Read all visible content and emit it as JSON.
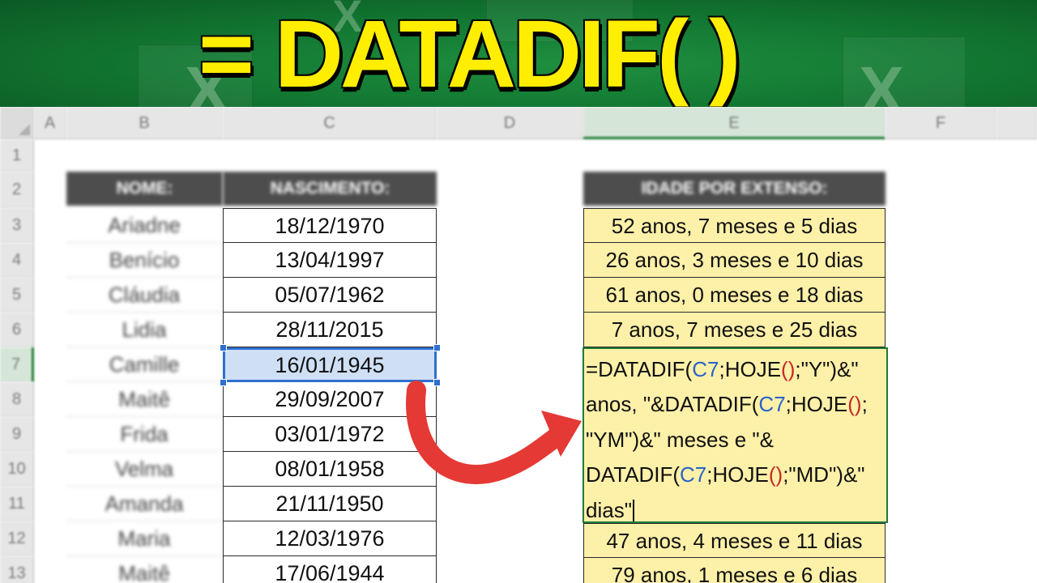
{
  "banner": {
    "title": "= DATADIF(  )",
    "logo_letter": "X"
  },
  "columns": [
    "A",
    "B",
    "C",
    "D",
    "E",
    "F"
  ],
  "rows": [
    "1",
    "2",
    "3",
    "4",
    "5",
    "6",
    "7",
    "8",
    "9",
    "10",
    "11",
    "12",
    "13"
  ],
  "headers": {
    "nome": "NOME:",
    "nascimento": "NASCIMENTO:",
    "idade": "IDADE POR EXTENSO:"
  },
  "people": [
    {
      "name": "Ariadne",
      "birth": "18/12/1970"
    },
    {
      "name": "Benício",
      "birth": "13/04/1997"
    },
    {
      "name": "Cláudia",
      "birth": "05/07/1962"
    },
    {
      "name": "Lidia",
      "birth": "28/11/2015"
    },
    {
      "name": "Camille",
      "birth": "16/01/1945"
    },
    {
      "name": "Maitê",
      "birth": "29/09/2007"
    },
    {
      "name": "Frida",
      "birth": "03/01/1972"
    },
    {
      "name": "Velma",
      "birth": "08/01/1958"
    },
    {
      "name": "Amanda",
      "birth": "21/11/1950"
    },
    {
      "name": "Maria",
      "birth": "12/03/1976"
    },
    {
      "name": "Maitê",
      "birth": "17/06/1944"
    }
  ],
  "results_top": [
    "52 anos, 7 meses e 5 dias",
    "26 anos, 3 meses e 10 dias",
    "61 anos, 0 meses e 18 dias",
    "7 anos, 7 meses e 25 dias"
  ],
  "results_bottom": [
    "47 anos, 4 meses e 11 dias",
    "79 anos, 1 meses e 6 dias"
  ],
  "formula_lines": [
    "=DATADIF(C7;HOJE();\"Y\")&\"",
    "anos, \"&DATADIF(C7;HOJE();",
    "\"YM\")&\" meses e \"&",
    "DATADIF(C7;HOJE();\"MD\")&\"",
    "dias\""
  ],
  "colors": {
    "banner_green": "#137a33",
    "title_yellow": "#ffee00",
    "result_fill": "#fdf0a8",
    "selection_blue": "#2f6fd0",
    "arrow_red": "#e53935",
    "header_dark": "#4d4d4d"
  }
}
